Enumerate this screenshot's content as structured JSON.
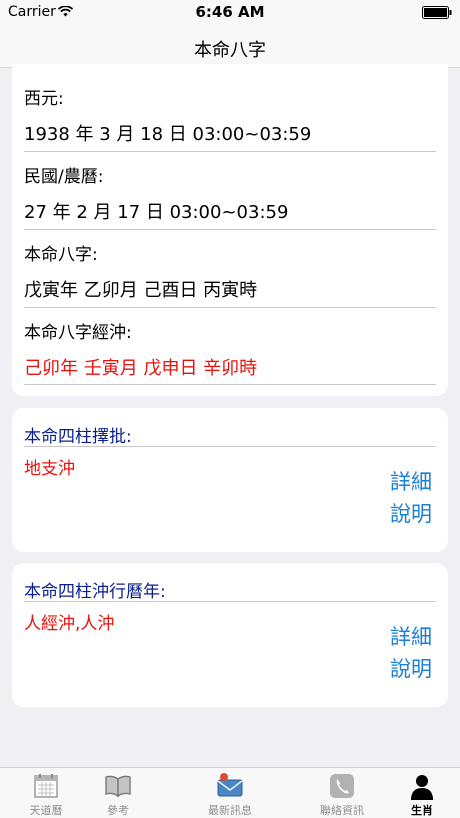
{
  "status": {
    "carrier": "Carrier",
    "time": "6:46 AM"
  },
  "nav": {
    "title": "本命八字"
  },
  "birth": {
    "western_label": "西元:",
    "western_value": "1938 年 3 月 18 日 03:00~03:59",
    "lunar_label": "民國/農曆:",
    "lunar_value": "27 年 2 月 17 日 03:00~03:59",
    "bazi_label": "本命八字:",
    "bazi_value": "戊寅年 乙卯月 己酉日 丙寅時",
    "clash_label": "本命八字經沖:",
    "clash_value": "己卯年 壬寅月 戊申日 辛卯時"
  },
  "section_pillars": {
    "title": "本命四柱擇批:",
    "result": "地支沖",
    "detail_line1": "詳細",
    "detail_line2": "說明"
  },
  "section_calendar": {
    "title": "本命四柱沖行曆年:",
    "result": "人經沖,人沖",
    "detail_line1": "詳細",
    "detail_line2": "說明"
  },
  "tabs": [
    {
      "label": "天道曆",
      "icon": "calendar-icon"
    },
    {
      "label": "參考",
      "icon": "book-icon"
    },
    {
      "label": "最新訊息",
      "icon": "mail-icon"
    },
    {
      "label": "聯絡資訊",
      "icon": "phone-icon"
    },
    {
      "label": "生肖",
      "icon": "person-icon",
      "active": true
    }
  ],
  "colors": {
    "accent": "#1a7fd6",
    "alert": "#e8120c",
    "section_title": "#0a1e8c"
  }
}
